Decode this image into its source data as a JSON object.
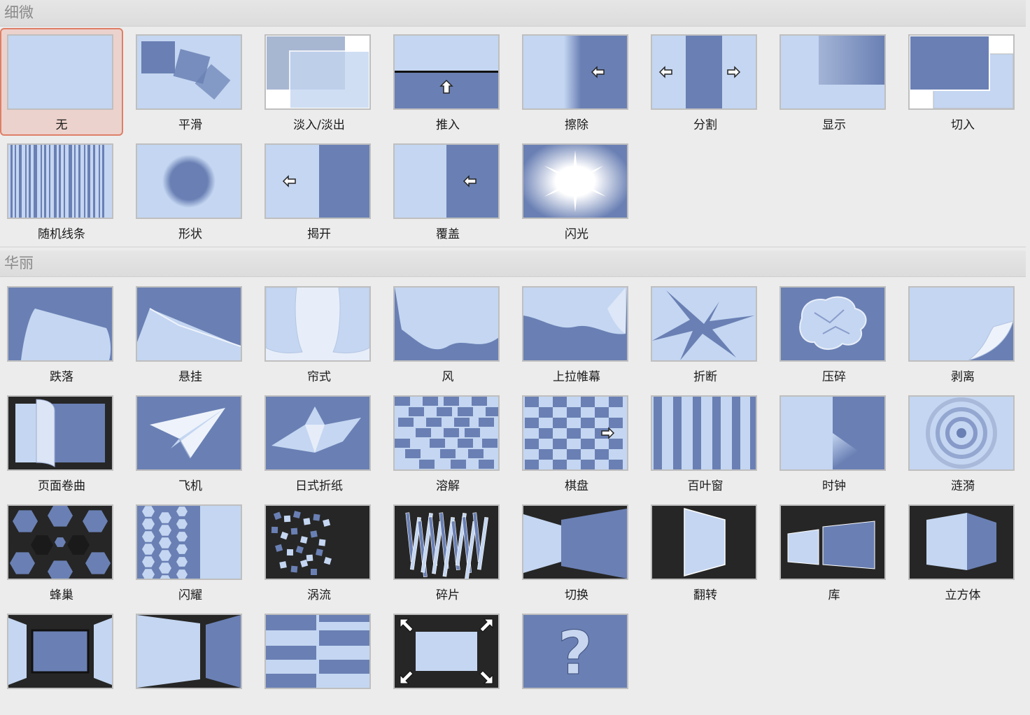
{
  "sections": [
    {
      "title": "细微",
      "items": [
        {
          "label": "无",
          "icon": "none-transition-icon",
          "selected": true
        },
        {
          "label": "平滑",
          "icon": "morph-transition-icon"
        },
        {
          "label": "淡入/淡出",
          "icon": "fade-transition-icon"
        },
        {
          "label": "推入",
          "icon": "push-transition-icon"
        },
        {
          "label": "擦除",
          "icon": "wipe-transition-icon"
        },
        {
          "label": "分割",
          "icon": "split-transition-icon"
        },
        {
          "label": "显示",
          "icon": "reveal-transition-icon"
        },
        {
          "label": "切入",
          "icon": "cut-transition-icon"
        },
        {
          "label": "随机线条",
          "icon": "random-bars-transition-icon"
        },
        {
          "label": "形状",
          "icon": "shape-transition-icon"
        },
        {
          "label": "揭开",
          "icon": "uncover-transition-icon"
        },
        {
          "label": "覆盖",
          "icon": "cover-transition-icon"
        },
        {
          "label": "闪光",
          "icon": "flash-transition-icon"
        }
      ]
    },
    {
      "title": "华丽",
      "items": [
        {
          "label": "跌落",
          "icon": "fall-over-transition-icon"
        },
        {
          "label": "悬挂",
          "icon": "drape-transition-icon"
        },
        {
          "label": "帘式",
          "icon": "curtains-transition-icon"
        },
        {
          "label": "风",
          "icon": "wind-transition-icon"
        },
        {
          "label": "上拉帷幕",
          "icon": "prestige-transition-icon"
        },
        {
          "label": "折断",
          "icon": "fracture-transition-icon"
        },
        {
          "label": "压碎",
          "icon": "crush-transition-icon"
        },
        {
          "label": "剥离",
          "icon": "peel-off-transition-icon"
        },
        {
          "label": "页面卷曲",
          "icon": "page-curl-transition-icon"
        },
        {
          "label": "飞机",
          "icon": "airplane-transition-icon"
        },
        {
          "label": "日式折纸",
          "icon": "origami-transition-icon"
        },
        {
          "label": "溶解",
          "icon": "dissolve-transition-icon"
        },
        {
          "label": "棋盘",
          "icon": "checkerboard-transition-icon"
        },
        {
          "label": "百叶窗",
          "icon": "blinds-transition-icon"
        },
        {
          "label": "时钟",
          "icon": "clock-transition-icon"
        },
        {
          "label": "涟漪",
          "icon": "ripple-transition-icon"
        },
        {
          "label": "蜂巢",
          "icon": "honeycomb-transition-icon"
        },
        {
          "label": "闪耀",
          "icon": "glitter-transition-icon"
        },
        {
          "label": "涡流",
          "icon": "vortex-transition-icon"
        },
        {
          "label": "碎片",
          "icon": "shred-transition-icon"
        },
        {
          "label": "切换",
          "icon": "switch-transition-icon"
        },
        {
          "label": "翻转",
          "icon": "flip-transition-icon"
        },
        {
          "label": "库",
          "icon": "gallery-transition-icon"
        },
        {
          "label": "立方体",
          "icon": "cube-transition-icon"
        },
        {
          "label": "",
          "icon": "doors-transition-icon"
        },
        {
          "label": "",
          "icon": "box-transition-icon"
        },
        {
          "label": "",
          "icon": "comb-transition-icon"
        },
        {
          "label": "",
          "icon": "zoom-transition-icon"
        },
        {
          "label": "",
          "icon": "random-transition-icon",
          "glyph": "?"
        }
      ]
    }
  ],
  "colors": {
    "light": "#c4d6f1",
    "dark": "#6a80b4",
    "black": "#262626",
    "selected_bg": "#ecd2cc",
    "selected_border": "#de7f67"
  }
}
